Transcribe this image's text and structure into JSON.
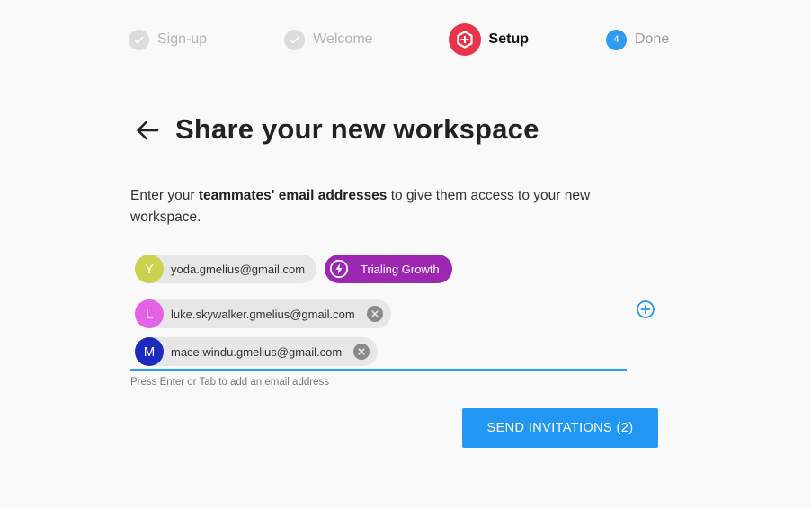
{
  "stepper": {
    "steps": [
      {
        "label": "Sign-up",
        "state": "done"
      },
      {
        "label": "Welcome",
        "state": "done"
      },
      {
        "label": "Setup",
        "state": "active"
      },
      {
        "label": "Done",
        "state": "todo",
        "number": "4"
      }
    ]
  },
  "page": {
    "title": "Share your new workspace",
    "desc_pre": "Enter your ",
    "desc_bold": "teammates' email addresses",
    "desc_post": " to give them access to your new workspace."
  },
  "chips": [
    {
      "initial": "Y",
      "email": "yoda.gmelius@gmail.com",
      "color": "#cdd14e"
    },
    {
      "initial": "L",
      "email": "luke.skywalker.gmelius@gmail.com",
      "color": "#e362e6"
    },
    {
      "initial": "M",
      "email": "mace.windu.gmelius@gmail.com",
      "color": "#1a2bbd"
    }
  ],
  "plan_badge": {
    "label": "Trialing Growth",
    "color": "#9c27b0"
  },
  "input": {
    "hint": "Press Enter or Tab to add an email address"
  },
  "actions": {
    "send_label": "SEND INVITATIONS (2)"
  },
  "colors": {
    "accent": "#2196f3",
    "brand": "#e8334a"
  },
  "icons": {
    "back": "arrow-left-icon",
    "done_step": "check-icon",
    "brand": "gmelius-logo-icon",
    "plan": "lightning-bolt-icon",
    "remove": "close-circle-icon",
    "add": "plus-circle-icon"
  }
}
